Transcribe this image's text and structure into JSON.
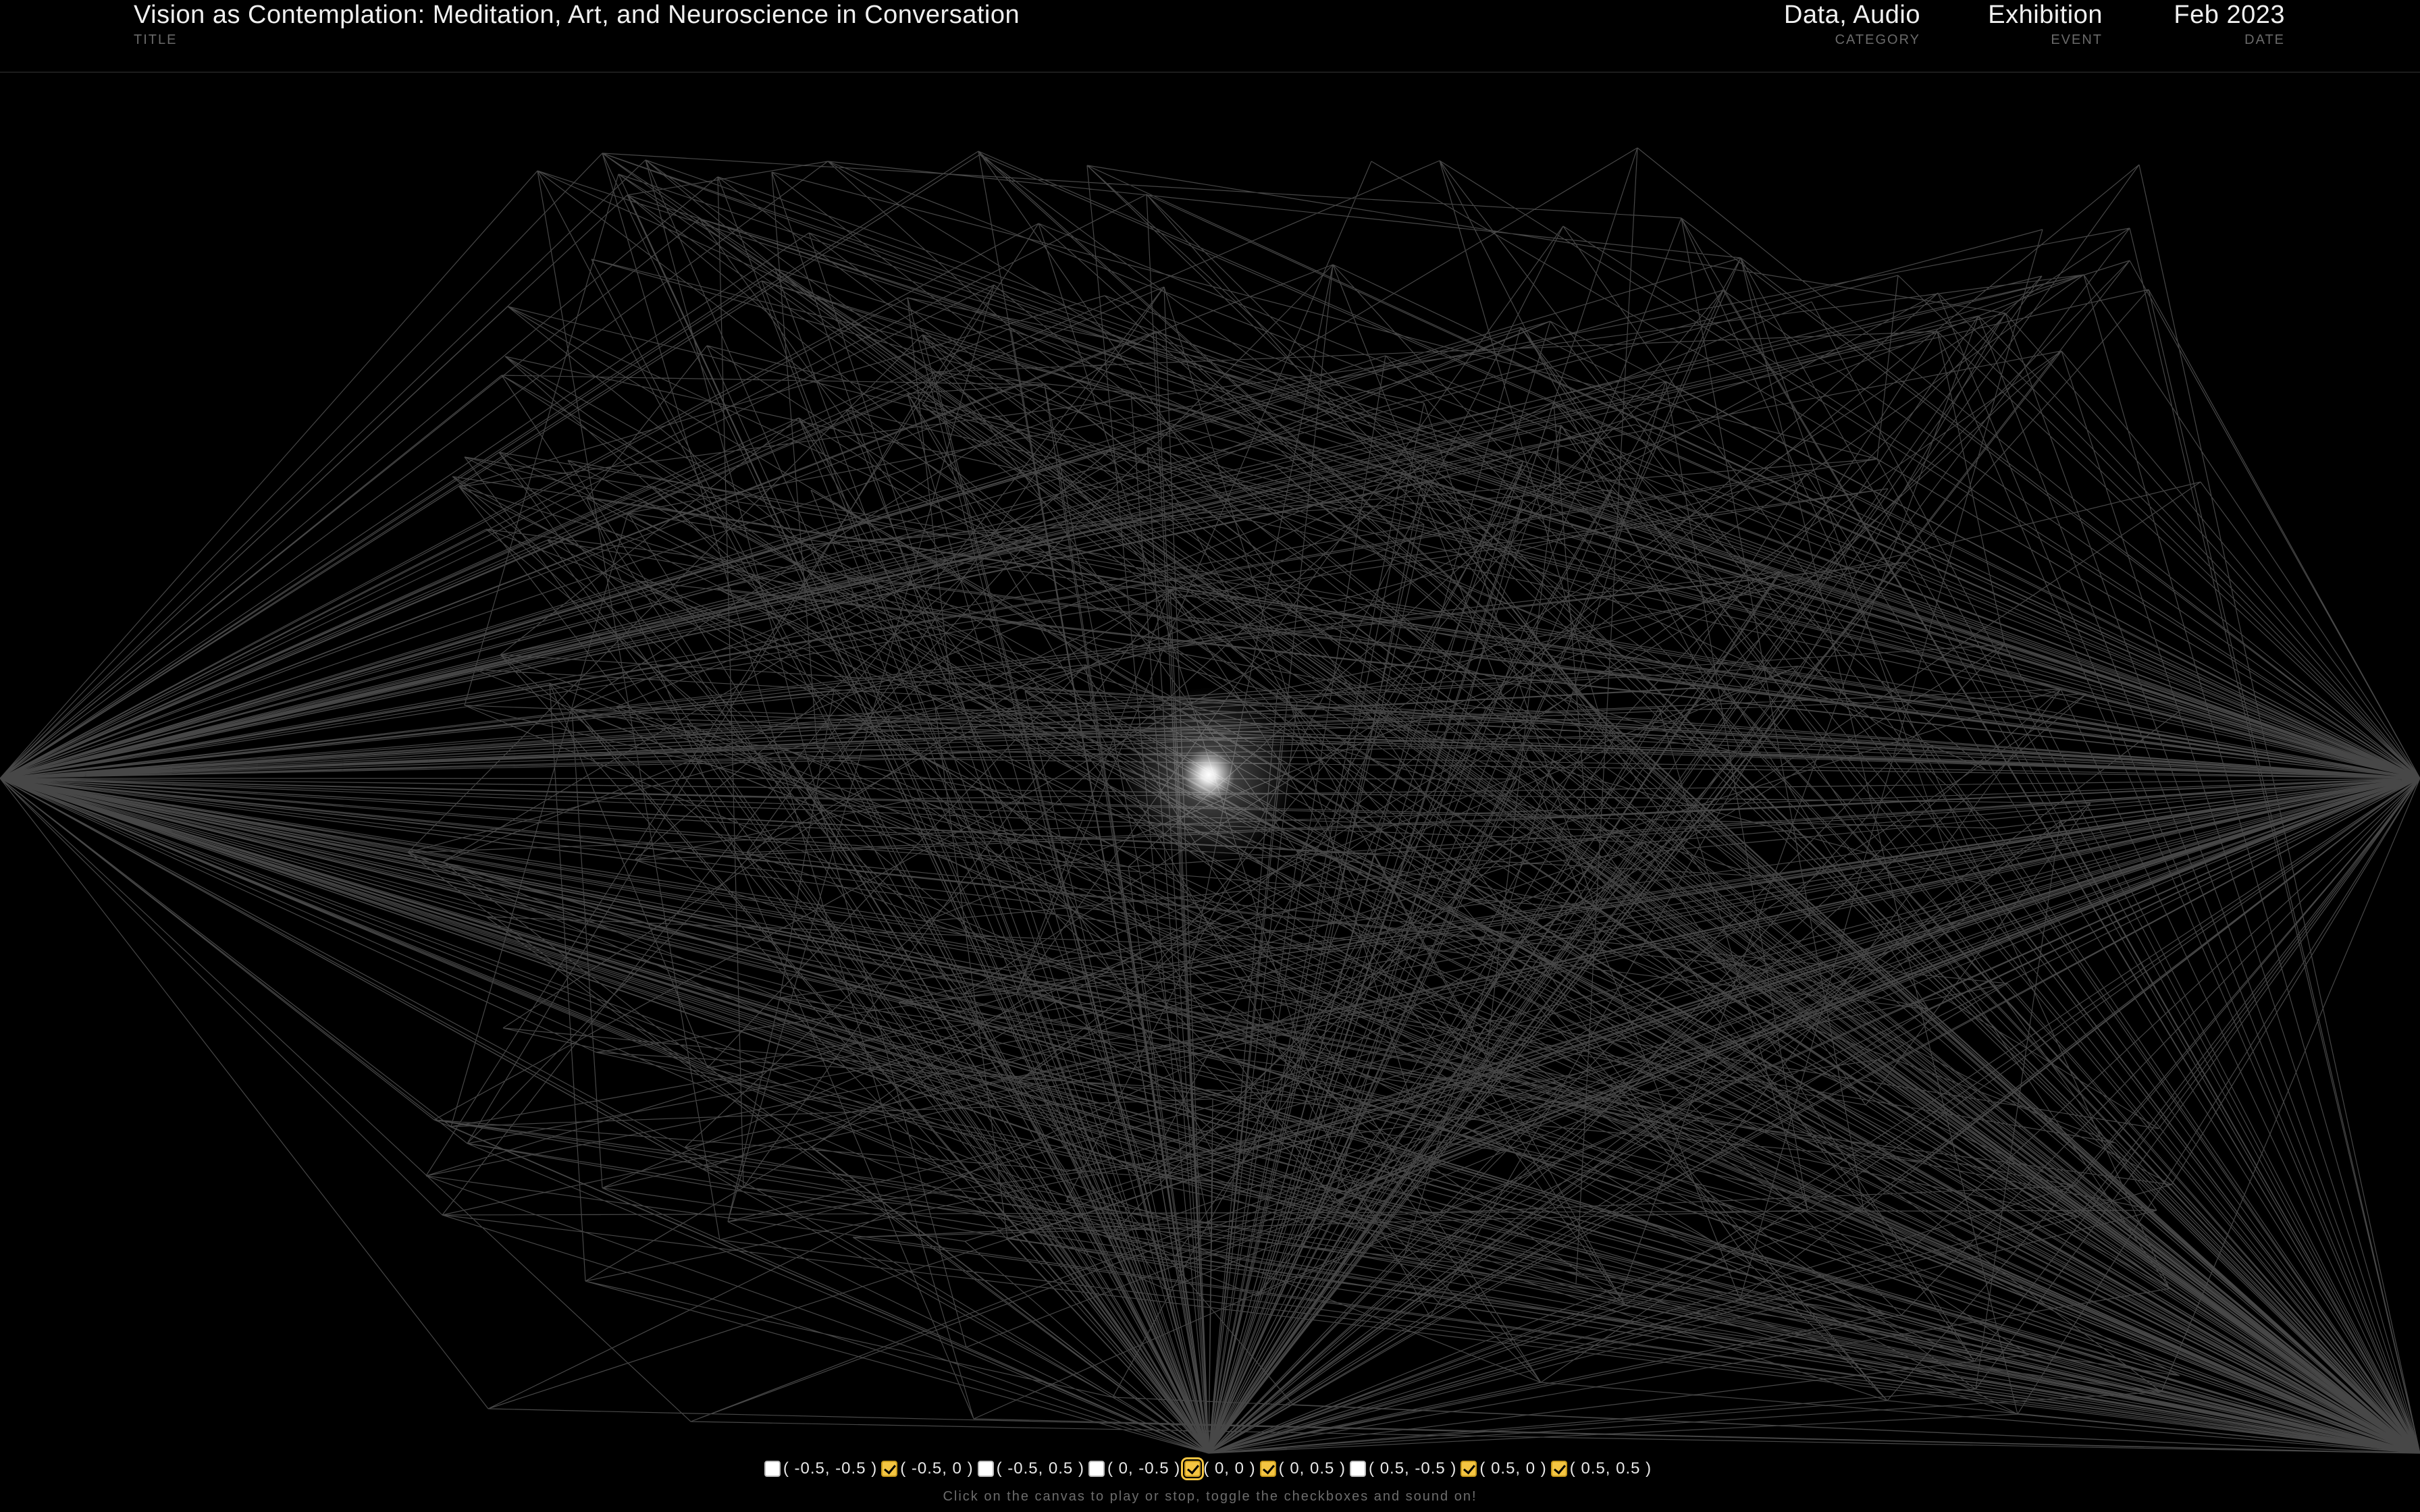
{
  "header": {
    "title": "Vision as Contemplation: Meditation, Art, and Neuroscience in Conversation",
    "title_label": "TITLE",
    "category": "Data, Audio",
    "category_label": "CATEGORY",
    "event": "Exhibition",
    "event_label": "EVENT",
    "date": "Feb 2023",
    "date_label": "DATE"
  },
  "controls": {
    "checkboxes": [
      {
        "label": "( -0.5, -0.5 )",
        "checked": false
      },
      {
        "label": "( -0.5, 0 )",
        "checked": true
      },
      {
        "label": "( -0.5, 0.5 )",
        "checked": false
      },
      {
        "label": "( 0, -0.5 )",
        "checked": false
      },
      {
        "label": "( 0, 0 )",
        "checked": true
      },
      {
        "label": "( 0, 0.5 )",
        "checked": true
      },
      {
        "label": "( 0.5, -0.5 )",
        "checked": false
      },
      {
        "label": "( 0.5, 0 )",
        "checked": true
      },
      {
        "label": "( 0.5, 0.5 )",
        "checked": true
      }
    ]
  },
  "hint": "Click on the canvas to play or stop, toggle the checkboxes and sound on!",
  "visual": {
    "line_color": "#ffffff",
    "background": "#000000",
    "accent": "#f4c542"
  }
}
